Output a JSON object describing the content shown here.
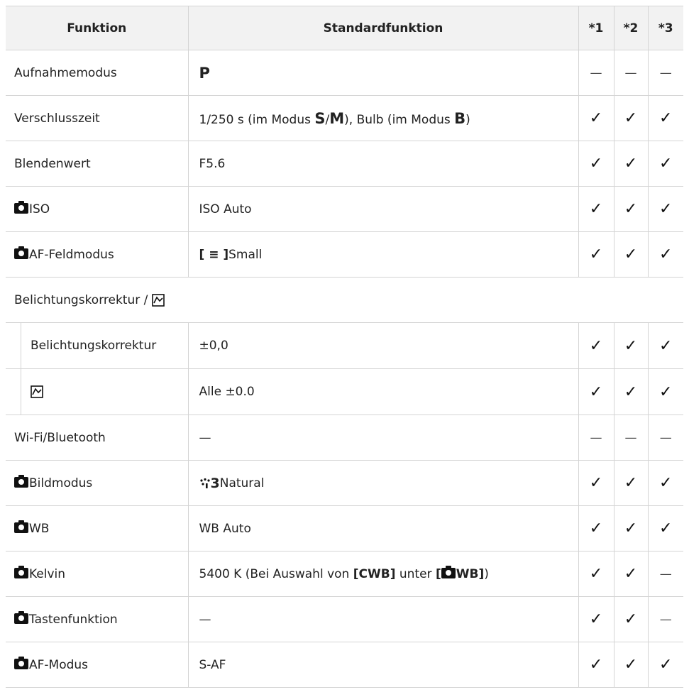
{
  "header": {
    "col_funktion": "Funktion",
    "col_standard": "Standardfunktion",
    "col_1": "*1",
    "col_2": "*2",
    "col_3": "*3"
  },
  "rows": [
    {
      "name": "Aufnahmemodus",
      "value": "P"
    },
    {
      "name": "Verschlusszeit",
      "value_a": "1/250 s (im Modus ",
      "value_s": "S",
      "value_slash": "/",
      "value_m": "M",
      "value_b": "), Bulb (im Modus ",
      "value_bb": "B",
      "value_c": ")"
    },
    {
      "name": "Blendenwert",
      "value": "F5.6"
    },
    {
      "name": "ISO",
      "value": "ISO Auto"
    },
    {
      "name": "AF-Feldmodus",
      "value_bracket": "[ ≡ ]",
      "value": "Small"
    },
    {
      "section": "Belichtungskorrektur / "
    },
    {
      "name": "Belichtungskorrektur",
      "value": "±0,0"
    },
    {
      "name": "",
      "value": "Alle ±0.0"
    },
    {
      "name": "Wi-Fi/Bluetooth",
      "value": "—"
    },
    {
      "name": "Bildmodus",
      "value_icon": "3",
      "value": "Natural"
    },
    {
      "name": "WB",
      "value": "WB Auto"
    },
    {
      "name": "Kelvin",
      "value_a": "5400 K (Bei Auswahl von ",
      "value_b": "[CWB]",
      "value_c": " unter ",
      "value_d": "[",
      "value_e": "WB]",
      "value_f": ")"
    },
    {
      "name": "Tastenfunktion",
      "value": "—"
    },
    {
      "name": "AF-Modus",
      "value": "S-AF"
    }
  ],
  "marks": {
    "check": "✓",
    "dash": "—"
  },
  "icons": {
    "camera": "camera-icon",
    "tone": "tone-curve-icon",
    "af": "af-target-icon",
    "picture": "picture-mode-icon"
  }
}
